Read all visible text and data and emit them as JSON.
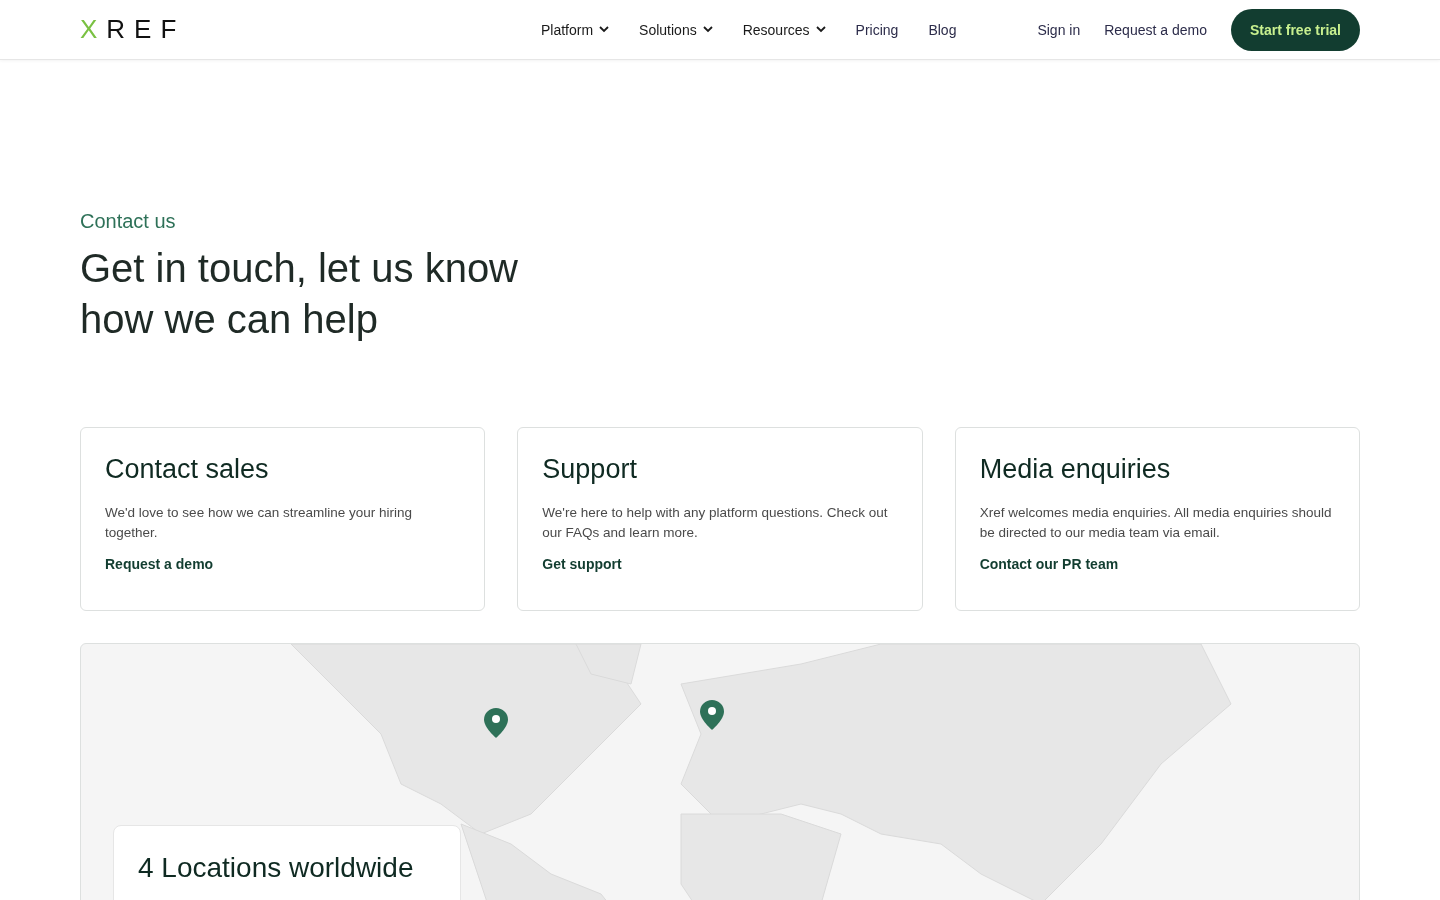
{
  "header": {
    "logo": {
      "mark": "X",
      "word": "REF"
    },
    "nav": [
      {
        "label": "Platform",
        "has_menu": true
      },
      {
        "label": "Solutions",
        "has_menu": true
      },
      {
        "label": "Resources",
        "has_menu": true
      },
      {
        "label": "Pricing",
        "has_menu": false
      },
      {
        "label": "Blog",
        "has_menu": false
      }
    ],
    "sign_in": "Sign in",
    "request_demo": "Request a demo",
    "cta": "Start free trial"
  },
  "hero": {
    "eyebrow": "Contact us",
    "title": "Get in touch, let us know how we can help"
  },
  "cards": [
    {
      "title": "Contact sales",
      "text": "We'd love to see how we can streamline your hiring together.",
      "link": "Request a demo"
    },
    {
      "title": "Support",
      "text": "We're here to help with any platform questions. Check out our FAQs and learn more.",
      "link": "Get support"
    },
    {
      "title": "Media enquiries",
      "text": "Xref welcomes media enquiries. All media enquiries should be directed to our media team via email.",
      "link": "Contact our PR team"
    }
  ],
  "map": {
    "title": "4 Locations worldwide"
  }
}
